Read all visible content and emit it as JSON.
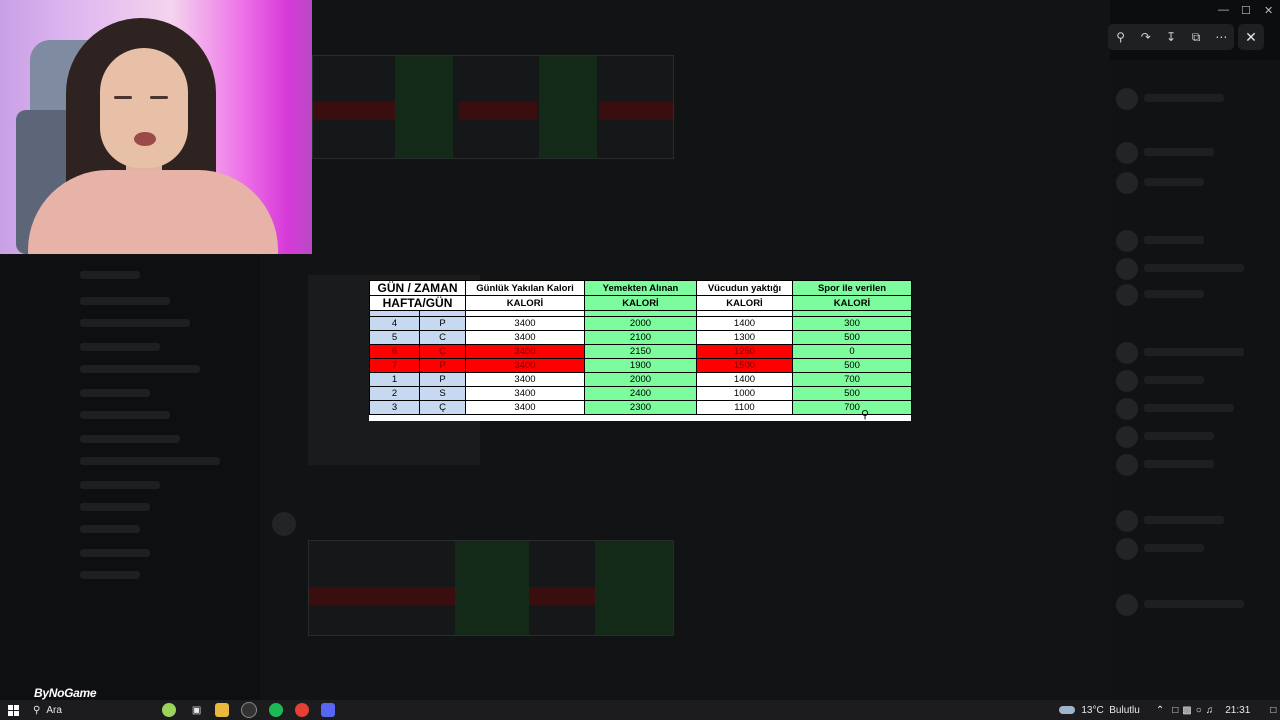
{
  "window": {
    "title_icon": "discord-icon",
    "controls": [
      "minimize",
      "maximize",
      "close"
    ]
  },
  "viewer_toolbar": {
    "icons": [
      "zoom-in-icon",
      "share-icon",
      "download-icon",
      "open-external-icon",
      "more-icon"
    ],
    "close_icon": "close-icon"
  },
  "sheet": {
    "header_row1": [
      "GÜN / ZAMAN",
      "Günlük Yakılan Kalori",
      "Yemekten Alınan",
      "Vücudun yaktığı",
      "Spor ile verilen"
    ],
    "header_row2": [
      "HAFTA/GÜN",
      "KALORİ",
      "KALORİ",
      "KALORİ",
      "KALORİ"
    ],
    "rows": [
      {
        "week": "4",
        "day": "P",
        "burned": "3400",
        "food": "2000",
        "body": "1400",
        "sport": "300",
        "highlight": false
      },
      {
        "week": "5",
        "day": "C",
        "burned": "3400",
        "food": "2100",
        "body": "1300",
        "sport": "500",
        "highlight": false
      },
      {
        "week": "6",
        "day": "Ç",
        "burned": "3400",
        "food": "2150",
        "body": "1250",
        "sport": "0",
        "highlight": true
      },
      {
        "week": "7",
        "day": "P",
        "burned": "3400",
        "food": "1900",
        "body": "1500",
        "sport": "500",
        "highlight": true
      },
      {
        "week": "1",
        "day": "P",
        "burned": "3400",
        "food": "2000",
        "body": "1400",
        "sport": "700",
        "highlight": false
      },
      {
        "week": "2",
        "day": "S",
        "burned": "3400",
        "food": "2400",
        "body": "1000",
        "sport": "500",
        "highlight": false
      },
      {
        "week": "3",
        "day": "Ç",
        "burned": "3400",
        "food": "2300",
        "body": "1100",
        "sport": "700",
        "highlight": false
      }
    ],
    "colors": {
      "green": "#7dfc9e",
      "blue": "#c6d9f1",
      "red": "#ff0000"
    }
  },
  "brand": "ByNoGame",
  "taskbar": {
    "search_label": "Ara",
    "weather": "13°C  Bulutlu",
    "time": "21:31"
  }
}
